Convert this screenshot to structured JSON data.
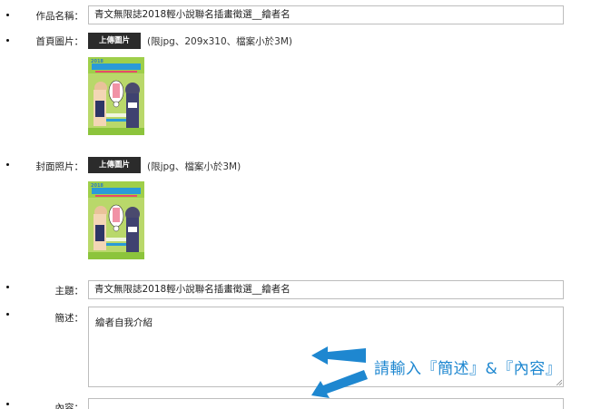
{
  "fields": {
    "title": {
      "label": "作品名稱：",
      "value": "青文無限誌2018輕小說聯名插畫徵選__繪者名"
    },
    "home_image": {
      "label": "首頁圖片：",
      "button": "上傳圖片",
      "hint": "(限jpg、209x310、檔案小於3M)"
    },
    "cover_image": {
      "label": "封面照片：",
      "button": "上傳圖片",
      "hint": "(限jpg、檔案小於3M)"
    },
    "subject": {
      "label": "主題：",
      "value": "青文無限誌2018輕小說聯名插畫徵選__繪者名"
    },
    "description": {
      "label": "簡述：",
      "value": "繪者自我介紹"
    },
    "content": {
      "label": "內容："
    }
  },
  "poster": {
    "year": "2018",
    "badge": "輕小說"
  },
  "annotation": {
    "text": "請輸入『簡述』&『內容』"
  },
  "colors": {
    "accent": "#1e87d0",
    "button_bg": "#2b2b2b",
    "border": "#bdbdbd"
  },
  "icons": {
    "arrow": "arrow-left-icon",
    "poster": "poster-thumbnail"
  }
}
